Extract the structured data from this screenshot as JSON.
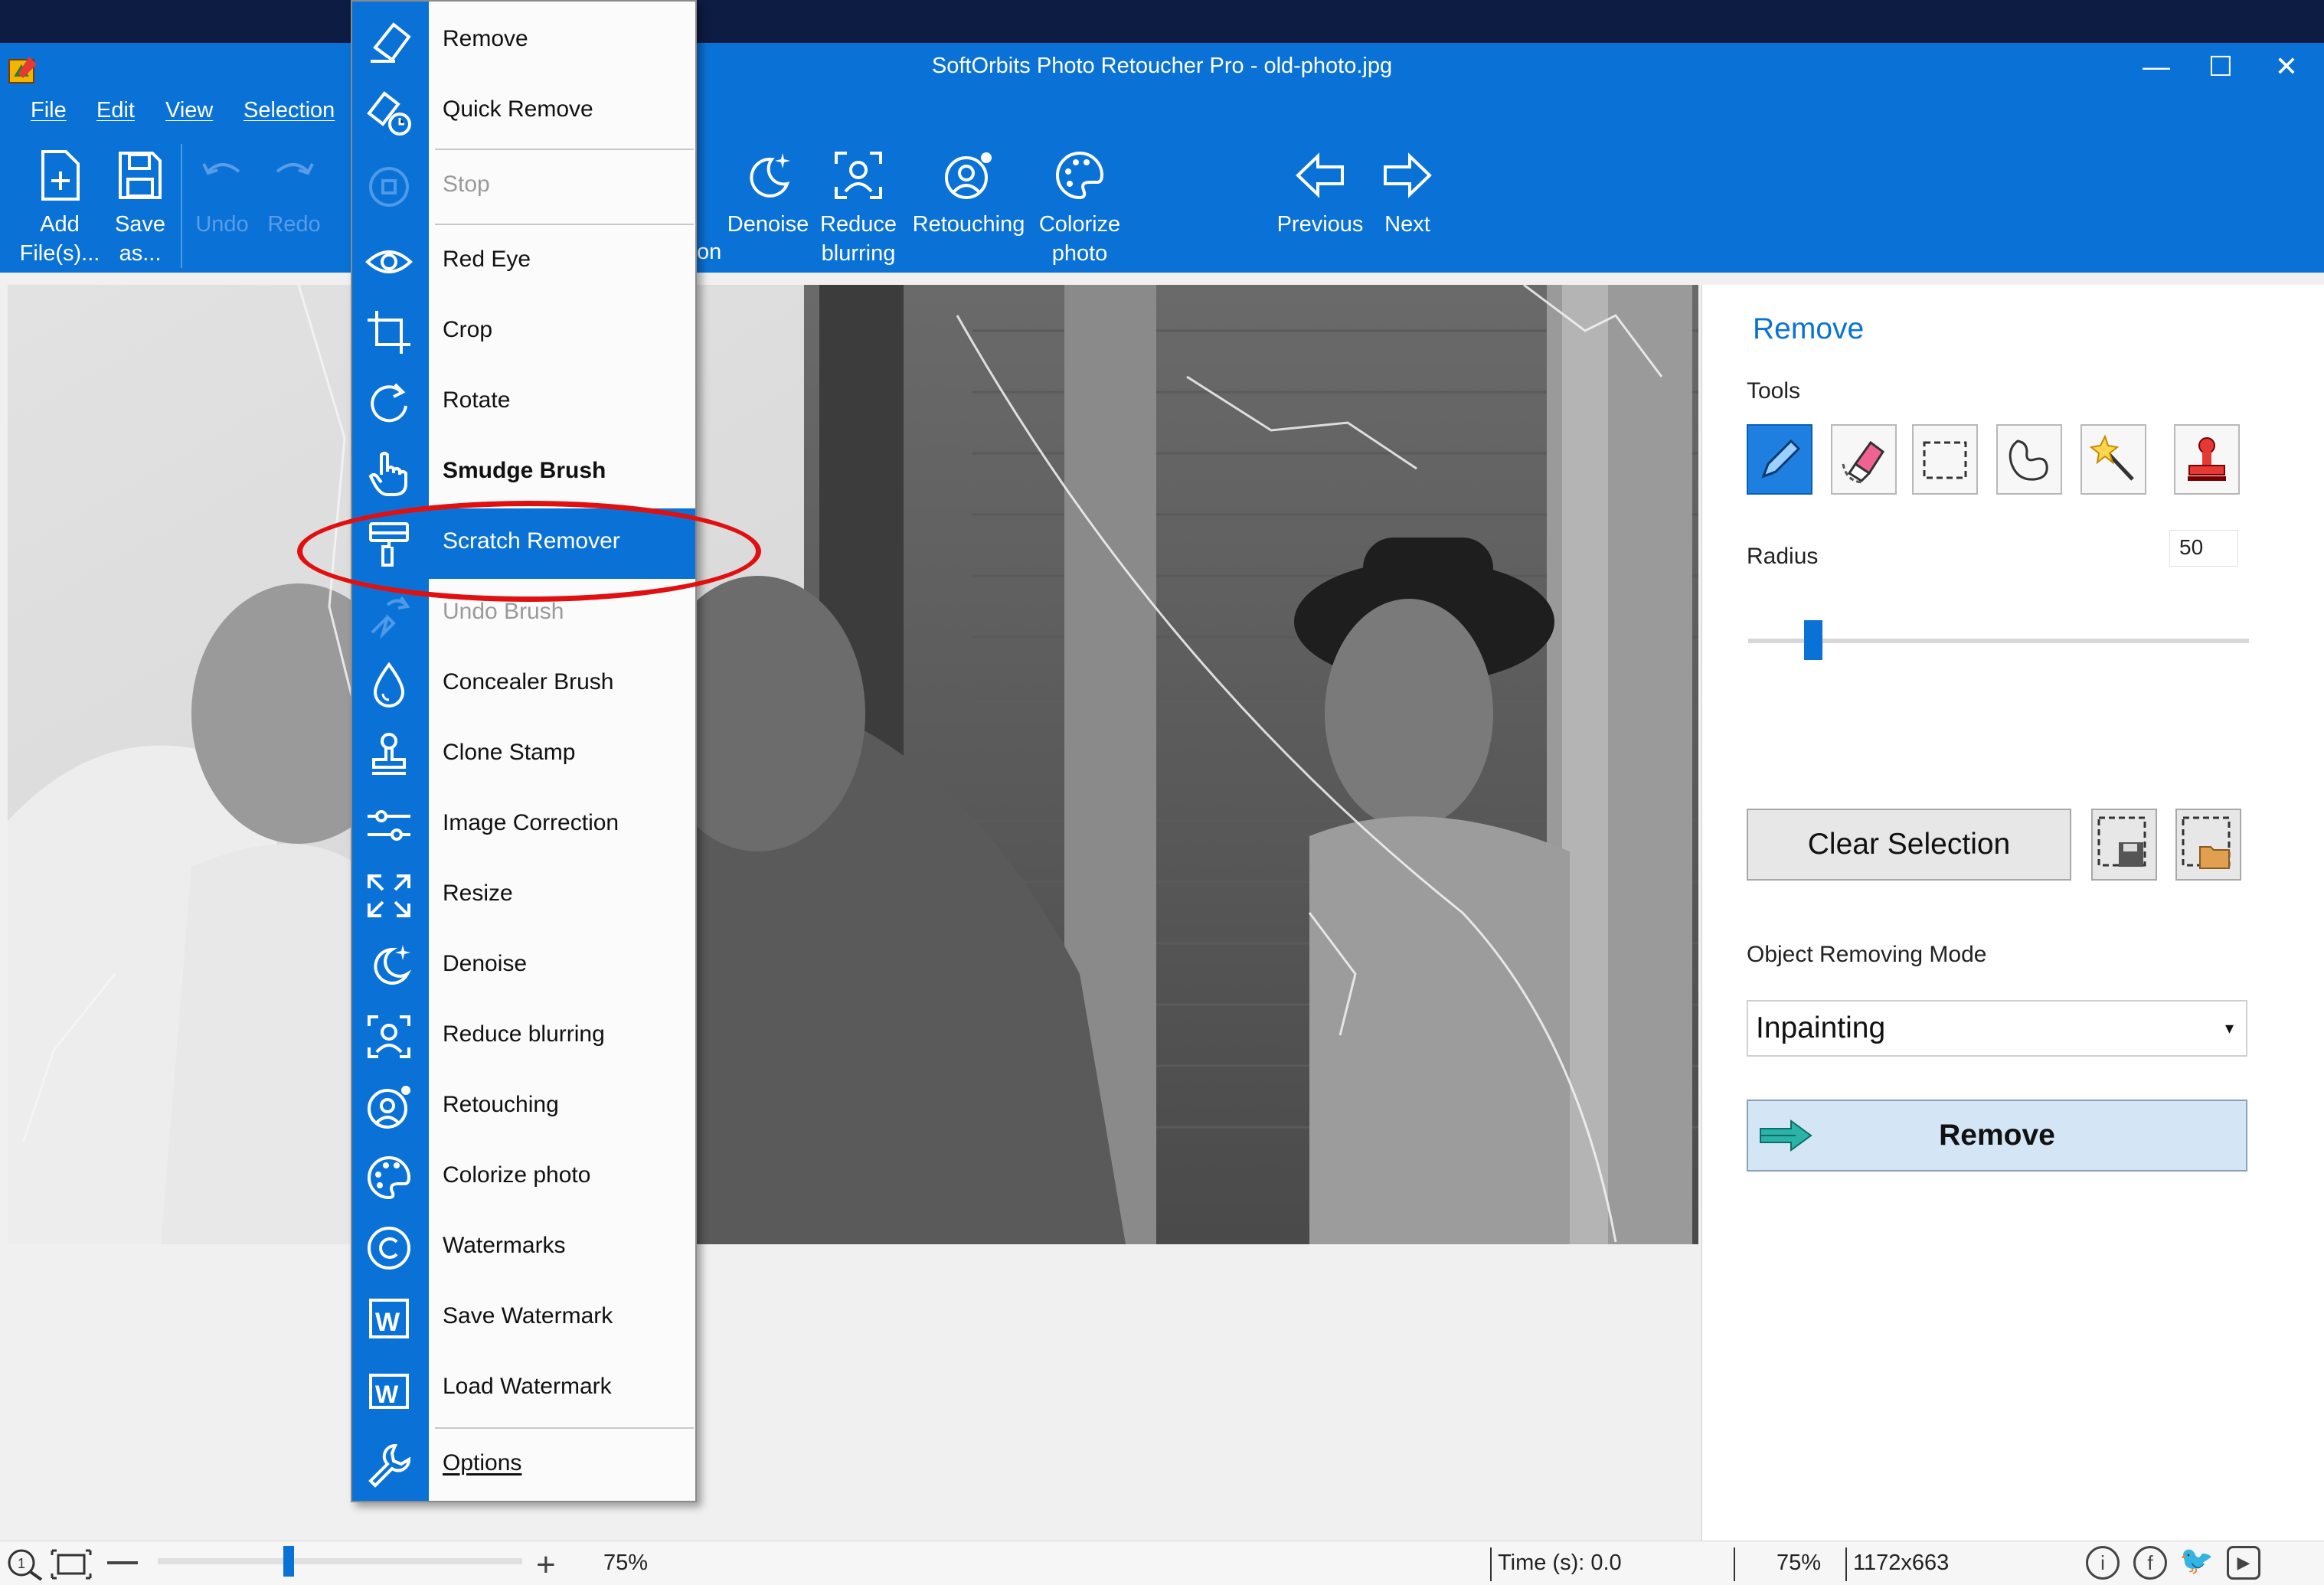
{
  "window": {
    "title": "SoftOrbits Photo Retoucher Pro - old-photo.jpg",
    "controls": {
      "minimize": "—",
      "maximize": "☐",
      "close": "✕"
    }
  },
  "menubar": [
    "File",
    "Edit",
    "View",
    "Selection"
  ],
  "toolbar": {
    "add": [
      "Add",
      "File(s)..."
    ],
    "save": [
      "Save",
      "as..."
    ],
    "undo": "Undo",
    "redo": "Redo",
    "partial": "on",
    "denoise": "Denoise",
    "reduce": [
      "Reduce",
      "blurring"
    ],
    "retouching": "Retouching",
    "colorize": [
      "Colorize",
      "photo"
    ],
    "previous": "Previous",
    "next": "Next"
  },
  "menu": {
    "items": [
      {
        "label": "Remove",
        "icon": "eraser-icon"
      },
      {
        "label": "Quick Remove",
        "icon": "quick-eraser-icon"
      },
      {
        "label": "Stop",
        "icon": "stop-icon",
        "disabled": true
      },
      {
        "label": "Red Eye",
        "icon": "eye-icon"
      },
      {
        "label": "Crop",
        "icon": "crop-icon"
      },
      {
        "label": "Rotate",
        "icon": "rotate-icon"
      },
      {
        "label": "Smudge Brush",
        "icon": "hand-icon"
      },
      {
        "label": "Scratch Remover",
        "icon": "paint-roller-icon",
        "highlighted": true
      },
      {
        "label": "Undo Brush",
        "icon": "undo-brush-icon",
        "disabled": true
      },
      {
        "label": "Concealer Brush",
        "icon": "drop-icon"
      },
      {
        "label": "Clone Stamp",
        "icon": "stamp-icon"
      },
      {
        "label": "Image Correction",
        "icon": "sliders-icon"
      },
      {
        "label": "Resize",
        "icon": "resize-icon"
      },
      {
        "label": "Denoise",
        "icon": "moon-stars-icon"
      },
      {
        "label": "Reduce blurring",
        "icon": "focus-person-icon"
      },
      {
        "label": "Retouching",
        "icon": "face-gear-icon"
      },
      {
        "label": "Colorize photo",
        "icon": "palette-icon"
      },
      {
        "label": "Watermarks",
        "icon": "copyright-icon"
      },
      {
        "label": "Save Watermark",
        "icon": "watermark-save-icon"
      },
      {
        "label": "Load Watermark",
        "icon": "watermark-load-icon"
      },
      {
        "label": "Options",
        "icon": "wrench-icon"
      }
    ]
  },
  "panel": {
    "title": "Remove",
    "tools_label": "Tools",
    "radius_label": "Radius",
    "radius_value": "50",
    "radius_level": 0.13,
    "clear_selection": "Clear Selection",
    "mode_label": "Object Removing Mode",
    "mode_value": "Inpainting",
    "remove_button": "Remove"
  },
  "status": {
    "zoom": "75%",
    "zoom_level": 0.36,
    "time": "Time (s): 0.0",
    "zoom2": "75%",
    "dimensions": "1172x663"
  },
  "colors": {
    "accent": "#0a72d6",
    "highlight_ring": "#e01010"
  }
}
